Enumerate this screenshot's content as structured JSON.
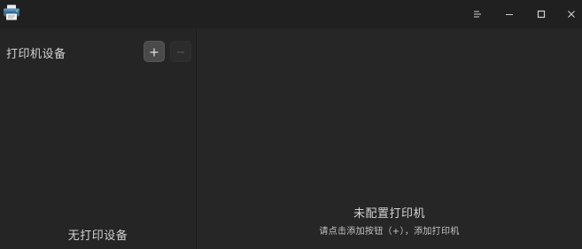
{
  "window": {
    "app_icon": "printer-icon",
    "controls": [
      "menu-icon",
      "minimize-icon",
      "maximize-icon",
      "close-icon"
    ]
  },
  "sidebar": {
    "title": "打印机设备",
    "add_icon": "plus-icon",
    "remove_icon": "minus-icon",
    "empty_text": "无打印设备"
  },
  "main": {
    "empty_title": "未配置打印机",
    "empty_hint": "请点击添加按钮（+），添加打印机"
  }
}
